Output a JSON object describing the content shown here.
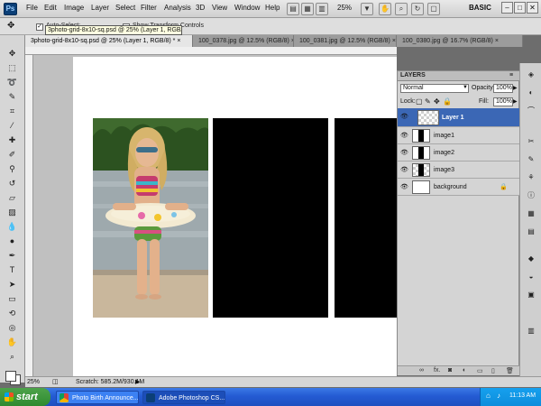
{
  "menubar": {
    "logo": "Ps",
    "items": [
      "File",
      "Edit",
      "Image",
      "Layer",
      "Select",
      "Filter",
      "Analysis",
      "3D",
      "View",
      "Window",
      "Help"
    ],
    "zoom": "25%",
    "workspace": "BASIC",
    "window_buttons": [
      "–",
      "□",
      "✕"
    ]
  },
  "options": {
    "auto_select_label": "Auto-Select:",
    "transform_label": "Show Transform Controls"
  },
  "tooltip": "3photo-grid-8x10-sq.psd @ 25% (Layer 1, RGB/8)",
  "tabs": [
    {
      "label": "3photo-grid-8x10-sq.psd @ 25% (Layer 1, RGB/8) *",
      "close": "×"
    },
    {
      "label": "100_0378.jpg @ 12.5% (RGB/8)",
      "close": "×"
    },
    {
      "label": "100_0381.jpg @ 12.5% (RGB/8)",
      "close": "×"
    },
    {
      "label": "100_0380.jpg @ 16.7% (RGB/8)",
      "close": "×"
    }
  ],
  "layers_panel": {
    "title": "LAYERS",
    "blend_mode": "Normal",
    "opacity_label": "Opacity:",
    "opacity_value": "100%",
    "lock_label": "Lock:",
    "fill_label": "Fill:",
    "fill_value": "100%",
    "layers": [
      {
        "name": "Layer 1",
        "selected": true
      },
      {
        "name": "image1",
        "selected": false
      },
      {
        "name": "image2",
        "selected": false
      },
      {
        "name": "image3",
        "selected": false
      },
      {
        "name": "background",
        "selected": false
      }
    ],
    "footer_icons": [
      "∞",
      "fx.",
      "◙",
      "◐",
      "▭",
      "▯",
      "🗑"
    ]
  },
  "status": {
    "zoom": "25%",
    "scratch": "Scratch: 585.2M/930.1M"
  },
  "taskbar": {
    "start": "start",
    "tasks": [
      {
        "label": "Photo Birth Announce...",
        "active": false
      },
      {
        "label": "Adobe Photoshop CS...",
        "active": true
      }
    ],
    "clock": "11:13 AM"
  },
  "colors": {
    "selected_layer": "#3b67b5",
    "taskbar": "#245bd3",
    "start_button": "#2e8a30"
  }
}
